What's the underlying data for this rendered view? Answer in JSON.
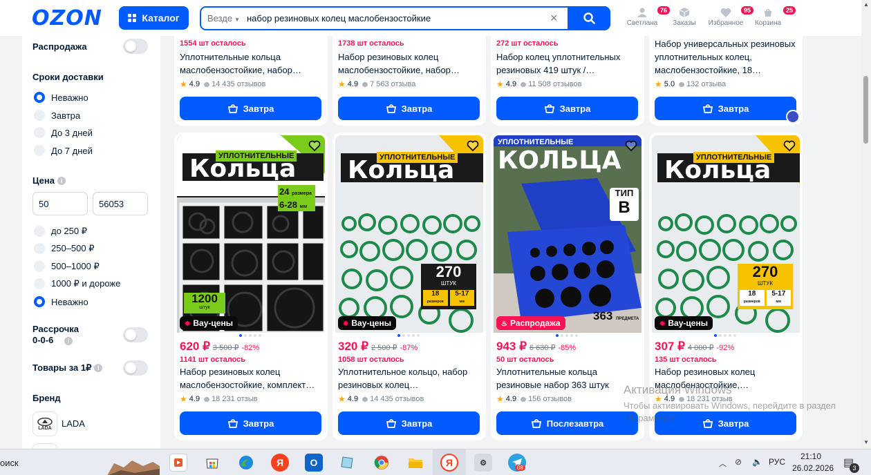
{
  "header": {
    "logo": "OZON",
    "catalog_label": "Каталог",
    "search_scope": "Везде",
    "search_query": "набор резиновых колец маслобензостойкие",
    "icons": [
      {
        "label": "Светлана",
        "badge": "76"
      },
      {
        "label": "Заказы",
        "badge": ""
      },
      {
        "label": "Избранное",
        "badge": "95"
      },
      {
        "label": "Корзина",
        "badge": "25"
      }
    ]
  },
  "sidebar": {
    "sale_label": "Распродажа",
    "delivery_title": "Сроки доставки",
    "delivery_options": [
      "Неважно",
      "Завтра",
      "До 3 дней",
      "До 7 дней"
    ],
    "price_title": "Цена",
    "price_from": "50",
    "price_to": "56053",
    "price_options": [
      "до 250 ₽",
      "250–500 ₽",
      "500–1000 ₽",
      "1000 ₽ и дороже",
      "Неважно"
    ],
    "installment_label": "Рассрочка\n0-0-6",
    "one_rub_label": "Товары за 1₽",
    "brand_title": "Бренд",
    "brand_name": "LADA",
    "brand_logo_text": "LADA"
  },
  "top_row": [
    {
      "left": "1554 шт осталось",
      "title": "Уплотнительные кольца маслобензостойкие, набор…",
      "rating": "4.9",
      "reviews": "14 435 отзывов",
      "button": "Завтра"
    },
    {
      "left": "1738 шт осталось",
      "title": "Набор резиновых колец маслобензостойкие, набор…",
      "rating": "4.9",
      "reviews": "7 563 отзыва",
      "button": "Завтра"
    },
    {
      "left": "272 шт осталось",
      "title": "Набор колец уплотнительных резиновых 419 штук /…",
      "rating": "4.9",
      "reviews": "11 508 отзывов",
      "button": "Завтра"
    },
    {
      "left": "",
      "title": "Набор универсальных резиновых уплотнительных колец, маслобензостойкие, 18…",
      "rating": "5.0",
      "reviews": "132 отзыва",
      "button": "Завтра"
    }
  ],
  "products": [
    {
      "img": {
        "top": "уплотнительные",
        "big": "Кольца",
        "chip1": "24",
        "chip1s": "размера",
        "chip2": "6-28",
        "chip2s": "мм",
        "count": "1200",
        "count_sub": "штук"
      },
      "tag": "Вау-цены",
      "price": "620 ₽",
      "old": "3 500 ₽",
      "discount": "-82%",
      "left": "1141 шт осталось",
      "title": "Набор резиновых колец маслобензостойкие, комплект…",
      "rating": "4.9",
      "reviews": "18 231 отзыв",
      "button": "Завтра"
    },
    {
      "img": {
        "top": "уплотнительные",
        "big": "Кольца",
        "count": "270",
        "count_sub": "штук",
        "s1": "18",
        "s1s": "размеров",
        "s2": "5-17",
        "s2s": "мм"
      },
      "tag": "Вау-цены",
      "price": "320 ₽",
      "old": "2 500 ₽",
      "discount": "-87%",
      "left": "1058 шт осталось",
      "title": "Уплотнительное кольцо, набор резиновых колец…",
      "rating": "4.9",
      "reviews": "14 435 отзывов",
      "button": "Завтра"
    },
    {
      "img": {
        "top": "уплотнительные",
        "big": "кольца",
        "type_a": "тип",
        "type_b": "В",
        "count": "363",
        "count_sub": "предмета"
      },
      "tag": "Распродажа",
      "price": "943 ₽",
      "old": "6 630 ₽",
      "discount": "-85%",
      "left": "50 шт осталось",
      "title": "Уплотнительные кольца резиновые набор 363 штук",
      "rating": "4.9",
      "reviews": "156 отзывов",
      "button": "Послезавтра"
    },
    {
      "img": {
        "top": "уплотнительные",
        "big": "Кольца",
        "count": "270",
        "count_sub": "штук",
        "s1": "18",
        "s1s": "размеров",
        "s2": "5-17",
        "s2s": "мм"
      },
      "tag": "Вау-цены",
      "price": "307 ₽",
      "old": "4 000 ₽",
      "discount": "-92%",
      "left": "135 шт осталось",
      "title": "Набор резиновых колец маслобензостойкие,…",
      "rating": "4.9",
      "reviews": "18 231 отзыв",
      "button": "Завтра"
    }
  ],
  "watermark": {
    "line1": "Активация Windows",
    "line2": "Чтобы активировать Windows, перейдите в раздел \"Параметры\"."
  },
  "taskbar": {
    "search_fragment": "оиск",
    "lang": "РУС",
    "time": "21:10",
    "date": "26.02.2026",
    "notif_count": "3",
    "telegram_badge": "08"
  },
  "colors": {
    "brand": "#005bff",
    "price": "#f91155",
    "star": "#ffa800"
  }
}
